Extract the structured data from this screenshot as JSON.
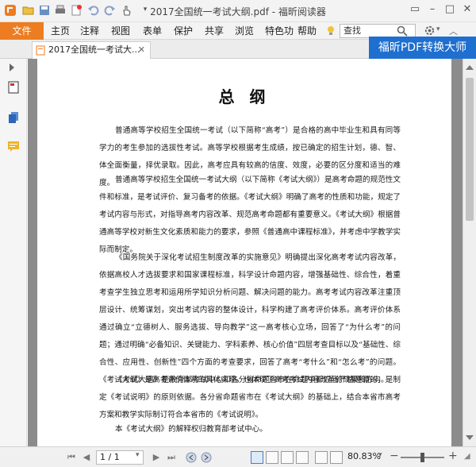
{
  "window": {
    "title": "2017全国统一考试大纲.pdf - 福昕阅读器"
  },
  "menu": {
    "file": "文件",
    "items": [
      "主页",
      "注释",
      "视图",
      "表单",
      "保护",
      "共享",
      "浏览",
      "特色功",
      "帮助"
    ],
    "search_value": "查找"
  },
  "tabs": {
    "doc_tab": "2017全国统一考试大..."
  },
  "promo": {
    "label": "福昕PDF转换大师"
  },
  "document": {
    "title": "总 纲",
    "paragraphs": [
      "普通高等学校招生全国统一考试（以下简称“高考”）是合格的高中毕业生和具有同等学力的考生参加的选拔性考试。高等学校根据考生成绩，按已确定的招生计划，德、智、体全面衡量，择优录取。因此，高考应具有较高的信度、效度，必要的区分度和适当的难度。",
      "普通高等学校招生全国统一考试大纲（以下简称《考试大纲》）是高考命题的规范性文件和标准，是考试评价、复习备考的依据。《考试大纲》明确了高考的性质和功能，规定了考试内容与形式，对指导高考内容改革、规范高考命题都有重要意义。《考试大纲》根据普通高等学校对新生文化素质和能力的要求，参照《普通高中课程标准》，并考虑中学教学实际而制定。",
      "《国务院关于深化考试招生制度改革的实施意见》明确提出深化高考考试内容改革，依据高校人才选拔要求和国家课程标准，科学设计命题内容，增强基础性、综合性，着重考查学生独立思考和运用所学知识分析问题、解决问题的能力。高考考试内容改革注重顶层设计、统筹谋划，突出考试内容的整体设计，科学构建了高考评价体系。高考评价体系通过确立“立德树人、服务选拔、导向教学”这一高考核心立场，回答了“为什么考”的问题；通过明确“必备知识、关键能力、学科素养、核心价值”四层考查目标以及“基础性、综合性、应用性、创新性”四个方面的考查要求，回答了高考“考什么”和“怎么考”的问题。《考试大纲》是高考评价体系的具体实现，也体现了高考考试内容改革的成果和方向。",
      "《考试大纲》是教育部考试中心和各分省命题省市在命题中都应当严格遵循的，是制定《考试说明》的原则依据。各分省命题省市在《考试大纲》的基础上，结合本省市高考方案和教学实际制订符合本省市的《考试说明》。",
      "本《考试大纲》的解释权归教育部考试中心。"
    ]
  },
  "status": {
    "page_input": "1 / 1",
    "zoom": "80.83%"
  },
  "colors": {
    "accent": "#ed7d20",
    "promo_bg": "#1e6fcf"
  }
}
